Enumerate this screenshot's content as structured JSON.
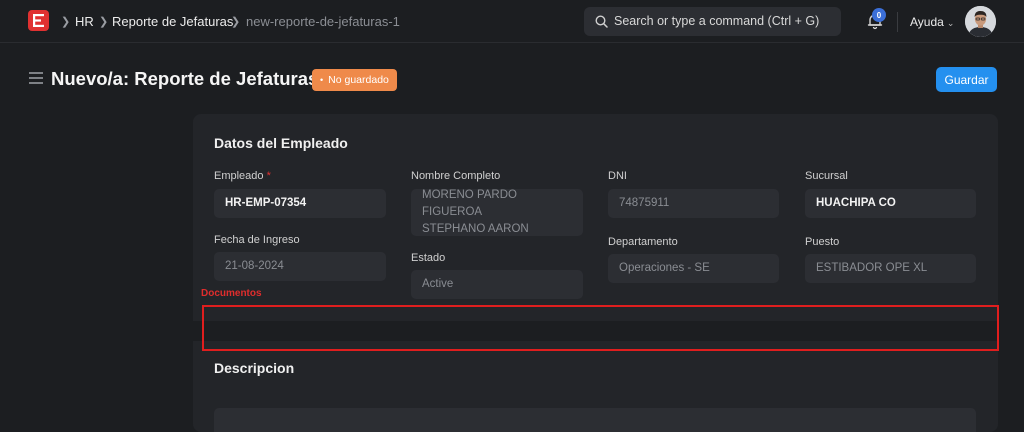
{
  "navbar": {
    "breadcrumbs": [
      "HR",
      "Reporte de Jefaturas",
      "new-reporte-de-jefaturas-1"
    ],
    "search_placeholder": "Search or type a command (Ctrl + G)",
    "notification_count": "0",
    "help_label": "Ayuda"
  },
  "page": {
    "title": "Nuevo/a: Reporte de Jefaturas",
    "status_badge": "No guardado",
    "save_label": "Guardar"
  },
  "employee_section": {
    "title": "Datos del Empleado",
    "fields": {
      "empleado": {
        "label": "Empleado",
        "required_mark": "*",
        "value": "HR-EMP-07354"
      },
      "fecha_ingreso": {
        "label": "Fecha de Ingreso",
        "value": "21-08-2024"
      },
      "nombre_completo": {
        "label": "Nombre Completo",
        "value_line1": "MORENO PARDO FIGUEROA",
        "value_line2": "STEPHANO AARON"
      },
      "estado": {
        "label": "Estado",
        "value": "Active"
      },
      "dni": {
        "label": "DNI",
        "value": "74875911"
      },
      "departamento": {
        "label": "Departamento",
        "value": "Operaciones - SE"
      },
      "sucursal": {
        "label": "Sucursal",
        "value": "HUACHIPA CO"
      },
      "puesto": {
        "label": "Puesto",
        "value": "ESTIBADOR OPE XL"
      }
    }
  },
  "documents_section": {
    "label": "Documentos"
  },
  "description_section": {
    "title": "Descripcion"
  },
  "colors": {
    "background": "#1c1e21",
    "card": "#232529",
    "input": "#2c2e33",
    "primary": "#2490ef",
    "warning_badge": "#ef8a4a",
    "annotation_red": "#e01e1e"
  }
}
